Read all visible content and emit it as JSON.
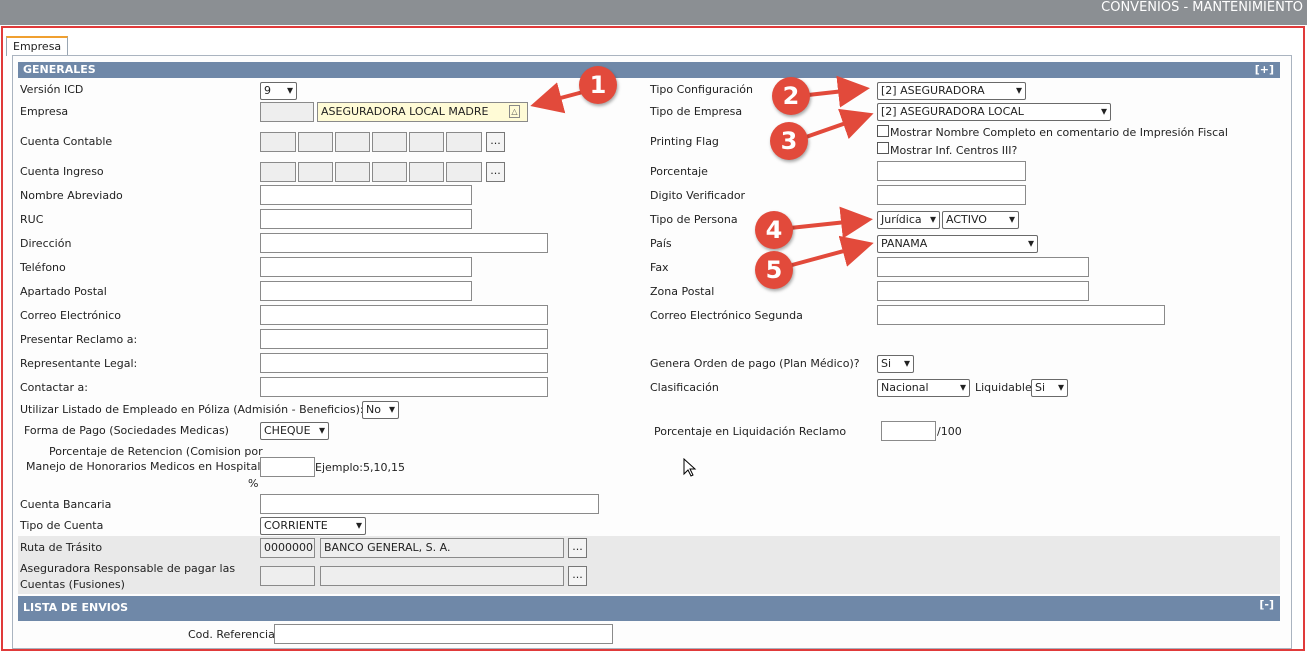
{
  "window": {
    "title": "CONVENIOS - MANTENIMIENTO"
  },
  "tabs": [
    {
      "label": "Empresa"
    }
  ],
  "sections": {
    "generales": {
      "title": "GENERALES",
      "toggle": "[+]"
    },
    "lista_envios": {
      "title": "LISTA DE ENVIOS",
      "toggle": "[-]"
    }
  },
  "left": {
    "version_icd": {
      "label": "Versión ICD",
      "value": "9"
    },
    "empresa": {
      "label": "Empresa",
      "code": "",
      "name": "ASEGURADORA LOCAL MADRE"
    },
    "cuenta_contable": {
      "label": "Cuenta Contable"
    },
    "cuenta_ingreso": {
      "label": "Cuenta Ingreso"
    },
    "nombre_abreviado": {
      "label": "Nombre Abreviado",
      "value": ""
    },
    "ruc": {
      "label": "RUC",
      "value": ""
    },
    "direccion": {
      "label": "Dirección",
      "value": ""
    },
    "telefono": {
      "label": "Teléfono",
      "value": ""
    },
    "apartado": {
      "label": "Apartado Postal",
      "value": ""
    },
    "correo": {
      "label": "Correo Electrónico",
      "value": ""
    },
    "presentar": {
      "label": "Presentar Reclamo a:",
      "value": ""
    },
    "representante": {
      "label": "Representante Legal:",
      "value": ""
    },
    "contactar": {
      "label": "Contactar a:",
      "value": ""
    },
    "utilizar_listado": {
      "label": "Utilizar Listado de Empleado en Póliza (Admisión - Beneficios):",
      "value": "No"
    },
    "forma_pago": {
      "label": "Forma de Pago (Sociedades Medicas)",
      "value": "CHEQUE"
    },
    "porcentaje_retencion": {
      "label_line1": "Porcentaje de Retencion (Comision por",
      "label_line2": "Manejo de Honorarios Medicos en Hospital)",
      "label_line3": "%",
      "value": "",
      "example": "Ejemplo:5,10,15"
    },
    "cuenta_bancaria": {
      "label": "Cuenta Bancaria",
      "value": ""
    },
    "tipo_cuenta": {
      "label": "Tipo de Cuenta",
      "value": "CORRIENTE"
    },
    "ruta_transito": {
      "label": "Ruta de Trásito",
      "code": "0000000",
      "name": "BANCO GENERAL, S. A."
    },
    "aseguradora_resp": {
      "label_line1": "Aseguradora Responsable de pagar las",
      "label_line2": "Cuentas (Fusiones)",
      "code": "",
      "name": ""
    }
  },
  "right": {
    "tipo_config": {
      "label": "Tipo Configuración",
      "value": "[2] ASEGURADORA"
    },
    "tipo_empresa": {
      "label": "Tipo de Empresa",
      "value": "[2] ASEGURADORA LOCAL"
    },
    "printing_flag": {
      "label": "Printing Flag",
      "opt1": "Mostrar Nombre Completo en comentario de Impresión Fiscal",
      "opt2": "Mostrar Inf. Centros III?"
    },
    "porcentaje": {
      "label": "Porcentaje",
      "value": ""
    },
    "digito": {
      "label": "Digito Verificador",
      "value": ""
    },
    "tipo_persona": {
      "label": "Tipo de Persona",
      "value": "Jurídica",
      "estado": "ACTIVO"
    },
    "pais": {
      "label": "País",
      "value": "PANAMA"
    },
    "fax": {
      "label": "Fax",
      "value": ""
    },
    "zona_postal": {
      "label": "Zona Postal",
      "value": ""
    },
    "correo_segunda": {
      "label": "Correo Electrónico Segunda",
      "value": ""
    },
    "genera_orden": {
      "label": "Genera Orden de pago (Plan Médico)?",
      "value": "Si"
    },
    "clasificacion": {
      "label": "Clasificación",
      "value": "Nacional",
      "liquidable_label": "Liquidable",
      "liquidable_value": "Si"
    },
    "porcentaje_liquidacion": {
      "label": "Porcentaje en Liquidación Reclamo",
      "value": "",
      "suffix": "/100"
    }
  },
  "lista_envios": {
    "cod_referencia": {
      "label": "Cod. Referencia",
      "value": ""
    }
  },
  "ellipsis": "...",
  "annotations": [
    "1",
    "2",
    "3",
    "4",
    "5"
  ],
  "colors": {
    "section_bar": "#6f88a8",
    "annotation": "#e24a3b",
    "frame_border": "#e03a3a",
    "lookup_highlight": "#fffbd6"
  }
}
